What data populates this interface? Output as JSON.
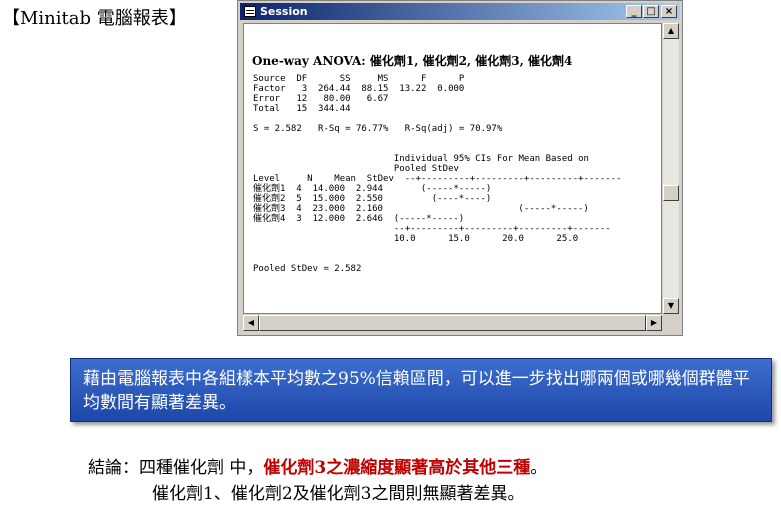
{
  "header": {
    "label": "【Minitab 電腦報表】"
  },
  "window": {
    "title": "Session",
    "buttons": {
      "minimize": "_",
      "maximize": "□",
      "close": "×"
    }
  },
  "session": {
    "title": "One-way ANOVA: 催化劑1, 催化劑2, 催化劑3, 催化劑4",
    "output_lines": [
      "Source  DF      SS     MS      F      P",
      "Factor   3  264.44  88.15  13.22  0.000",
      "Error   12   80.00   6.67",
      "Total   15  344.44",
      "",
      "S = 2.582   R-Sq = 76.77%   R-Sq(adj) = 70.97%",
      "",
      "",
      "                          Individual 95% CIs For Mean Based on",
      "                          Pooled StDev",
      "Level     N    Mean  StDev  --+---------+---------+---------+-------",
      "催化劑1  4  14.000  2.944       (-----*-----)",
      "催化劑2  5  15.000  2.550         (----*----)",
      "催化劑3  4  23.000  2.160                         (-----*-----)",
      "催化劑4  3  12.000  2.646  (-----*-----)",
      "                          --+---------+---------+---------+-------",
      "                          10.0      15.0      20.0      25.0",
      "",
      "",
      "Pooled StDev = 2.582"
    ]
  },
  "callout": {
    "text": "藉由電腦報表中各組樣本平均數之95%信賴區間，可以進一步找出哪兩個或哪幾個群體平均數間有顯著差異。"
  },
  "conclusion": {
    "prefix": "結論：四種催化劑 中，",
    "highlight": "催化劑3之濃縮度顯著高於其他三種",
    "suffix": "。",
    "line2": "催化劑1、催化劑2及催化劑3之間則無顯著差異。"
  },
  "colors": {
    "callout_bg": "#2f5fc4",
    "highlight": "#c00000",
    "titlebar": "#0a246a"
  }
}
